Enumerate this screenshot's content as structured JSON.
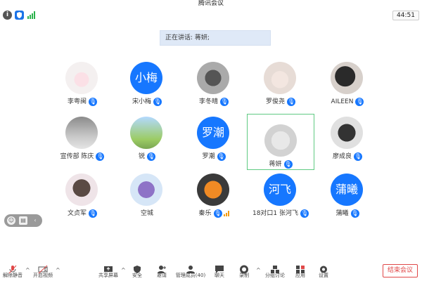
{
  "window": {
    "title": "腾讯会议"
  },
  "status": {
    "timer": "44:51",
    "info_icon": "i"
  },
  "speaking": {
    "text": "正在讲话: 蒋妍;"
  },
  "participants": [
    {
      "name": "李粤闽",
      "avatar_text": "",
      "mic": true
    },
    {
      "name": "宋小梅",
      "avatar_text": "小梅",
      "mic": true
    },
    {
      "name": "李冬晴",
      "avatar_text": "",
      "mic": true
    },
    {
      "name": "罗俊尧",
      "avatar_text": "",
      "mic": true
    },
    {
      "name": "AILEEN",
      "avatar_text": "",
      "mic": true
    },
    {
      "name": "宣传部 陈庆",
      "avatar_text": "",
      "mic": true
    },
    {
      "name": "锐",
      "avatar_text": "",
      "mic": true
    },
    {
      "name": "罗潮",
      "avatar_text": "罗潮",
      "mic": true
    },
    {
      "name": "蒋妍",
      "avatar_text": "",
      "mic": true,
      "active": true
    },
    {
      "name": "廖成良",
      "avatar_text": "",
      "mic": true
    },
    {
      "name": "文贞军",
      "avatar_text": "",
      "mic": true
    },
    {
      "name": "空城",
      "avatar_text": "",
      "mic": false
    },
    {
      "name": "秦乐",
      "avatar_text": "",
      "mic": true
    },
    {
      "name": "18对口1 张河飞",
      "avatar_text": "河飞",
      "mic": true
    },
    {
      "name": "蒲曦",
      "avatar_text": "蒲曦",
      "mic": true
    }
  ],
  "toolbar": {
    "unmute": "解除静音",
    "start_video": "开启视频",
    "share_screen": "共享屏幕",
    "security": "安全",
    "invite": "邀请",
    "manage_members": "管理成员(40)",
    "chat": "聊天",
    "record": "录制",
    "breakout": "分组讨论",
    "apps": "应用",
    "settings": "设置",
    "end_meeting": "结束会议"
  },
  "colors": {
    "accent": "#1677ff",
    "active_border": "#5fca82",
    "danger": "#e04848"
  }
}
